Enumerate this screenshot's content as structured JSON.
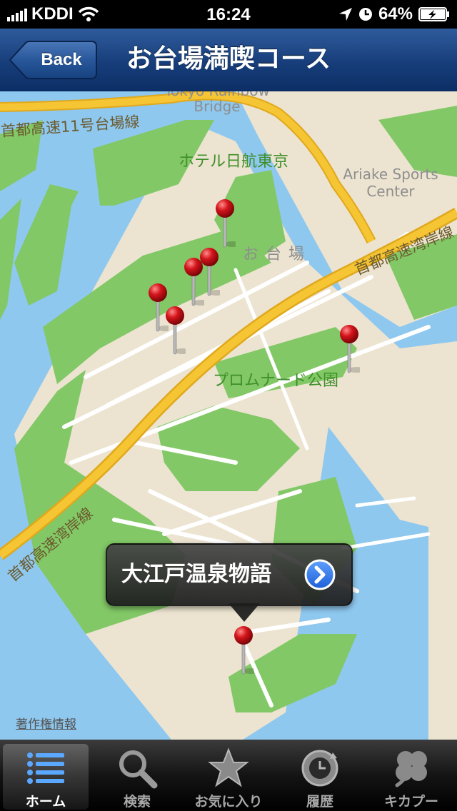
{
  "status_bar": {
    "carrier": "KDDI",
    "time": "16:24",
    "battery": "64%"
  },
  "nav": {
    "back_label": "Back",
    "title": "お台場満喫コース"
  },
  "map": {
    "labels": {
      "rainbow_bridge": "Tokyo Rainbow Bridge",
      "shutoko_11": "首都高速11号台場線",
      "hotel": "ホテル日航東京",
      "ariake": "Ariake Sports Center",
      "odaiba": "お台場",
      "wangan_top": "首都高速湾岸線",
      "wangan_bottom": "首都高速湾岸線",
      "promenade": "プロムナード公園"
    },
    "callout": {
      "title": "大江戸温泉物語"
    },
    "attribution": "著作権情報"
  },
  "tabbar": {
    "tabs": [
      {
        "label": "ホーム",
        "icon": "list-icon",
        "selected": true
      },
      {
        "label": "検索",
        "icon": "magnifier-icon"
      },
      {
        "label": "お気に入り",
        "icon": "star-icon"
      },
      {
        "label": "履歴",
        "icon": "history-clock-icon"
      },
      {
        "label": "キカプー",
        "icon": "clover-icon"
      }
    ]
  },
  "colors": {
    "water": "#8ec8ef",
    "land": "#ece4d1",
    "park": "#82c866",
    "highway": "#f5c533",
    "nav": "#1d4a8c",
    "pin": "#d4151b"
  }
}
